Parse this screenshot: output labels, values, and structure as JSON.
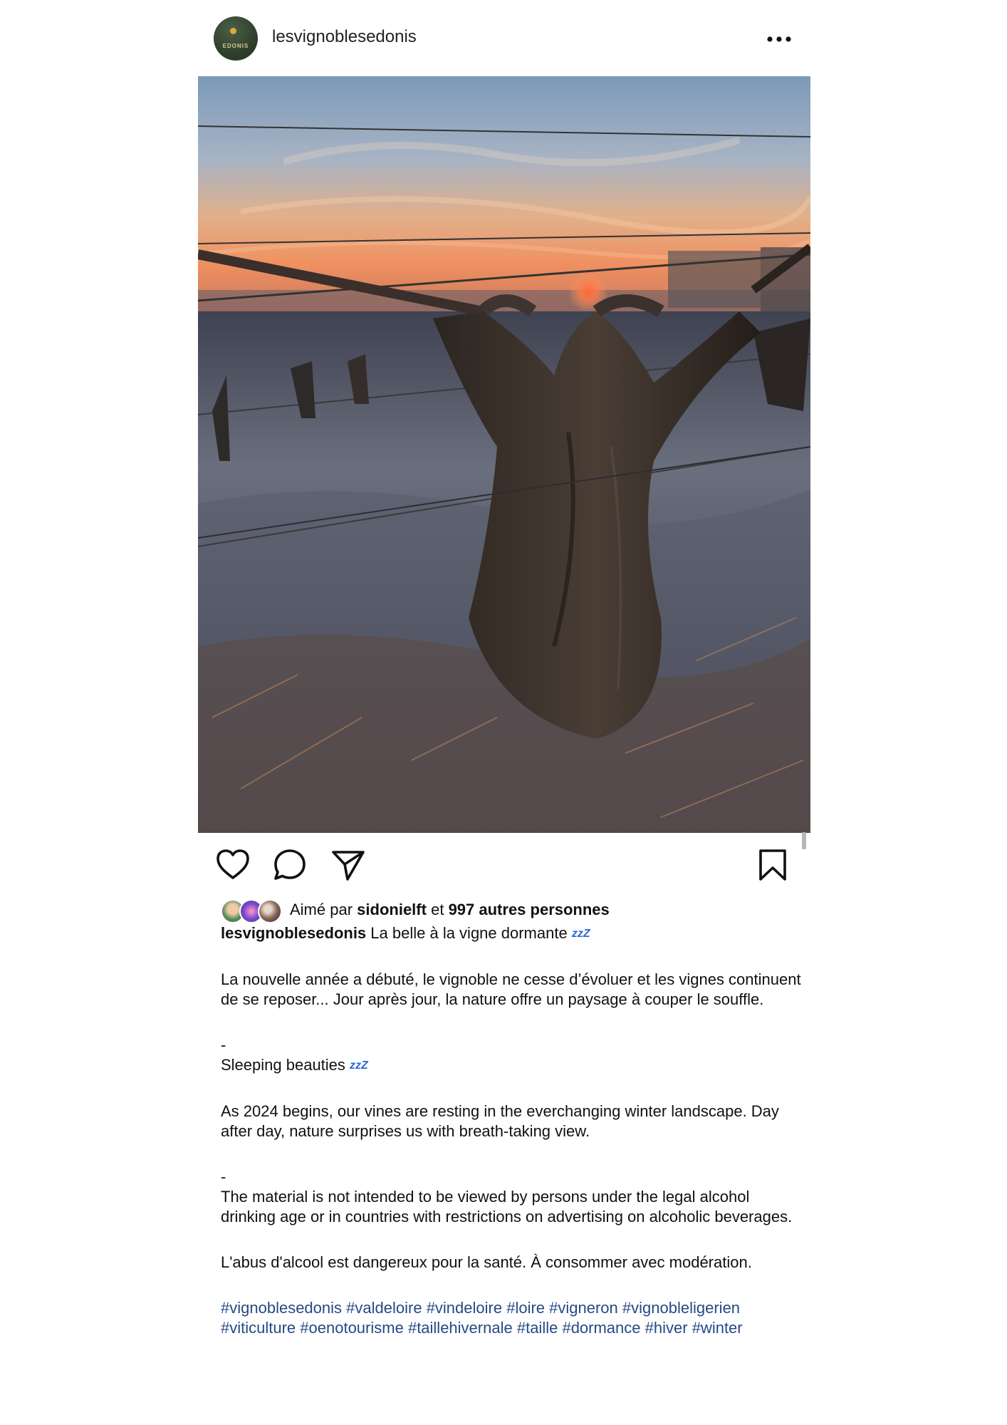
{
  "account": {
    "username": "lesvignoblesedonis",
    "avatar_text": "EDONIS",
    "more_icon": "more-horizontal-icon"
  },
  "actions": {
    "like_icon": "heart-icon",
    "comment_icon": "comment-icon",
    "share_icon": "send-icon",
    "save_icon": "bookmark-icon"
  },
  "likes": {
    "prefix": "Aimé par",
    "first_liker": "sidonielft",
    "connector": "et",
    "others": "997 autres personnes"
  },
  "caption": {
    "username": "lesvignoblesedonis",
    "title": "La belle à la vigne dormante",
    "title_emoji": "zzZ",
    "p1": "La nouvelle année a débuté, le vignoble ne cesse d’évoluer et les vignes continuent de se reposer... Jour après jour, la nature offre un paysage à couper le souffle.",
    "sep1": "-",
    "en_title": "Sleeping beauties",
    "en_title_emoji": "zzZ",
    "p2": "As 2024 begins, our vines are resting in the everchanging winter landscape. Day after day, nature surprises us with breath-taking view.",
    "sep2": "-",
    "p3": "The material is not intended to be viewed by persons under the legal alcohol drinking age or in countries with restrictions on advertising on alcoholic beverages.",
    "p4": "L'abus d'alcool est dangereux pour la santé. À consommer avec modération.",
    "hashtags": [
      "#vignoblesedonis",
      "#valdeloire",
      "#vindeloire",
      "#loire",
      "#vigneron",
      "#vignobleligerien",
      "#viticulture",
      " #oenotourisme",
      "#taillehivernale",
      "#taille",
      "#dormance",
      "#hiver",
      "#winter"
    ]
  },
  "colors": {
    "hashtag": "#254a84",
    "zzz": "#2b66d9",
    "avatar_bg": "#2d3b2a"
  }
}
